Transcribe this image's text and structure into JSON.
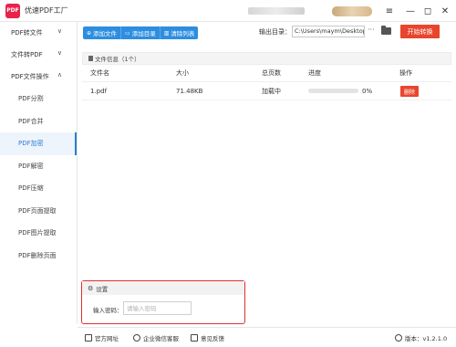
{
  "app": {
    "logo_text": "PDF",
    "title": "优速PDF工厂"
  },
  "window_controls": {
    "menu": "≡",
    "minimize": "—",
    "maximize": "◻",
    "close": "✕"
  },
  "sidebar": {
    "groups": [
      {
        "label": "PDF转文件",
        "chevron": "∨"
      },
      {
        "label": "文件转PDF",
        "chevron": "∨"
      },
      {
        "label": "PDF文件操作",
        "chevron": "∧"
      }
    ],
    "items": [
      {
        "label": "PDF分割"
      },
      {
        "label": "PDF合并"
      },
      {
        "label": "PDF加密",
        "active": true
      },
      {
        "label": "PDF解密"
      },
      {
        "label": "PDF压缩"
      },
      {
        "label": "PDF页面提取"
      },
      {
        "label": "PDF图片提取"
      },
      {
        "label": "PDF删除页面"
      }
    ]
  },
  "toolbar": {
    "add_file": "添加文件",
    "add_folder": "添加目录",
    "clear_list": "清除列表",
    "output_label": "输出目录：",
    "output_path": "C:\\Users\\maym\\Desktop",
    "more": "···",
    "start": "开始转换"
  },
  "file_list": {
    "info": "文件信息（1个）",
    "headers": {
      "name": "文件名",
      "size": "大小",
      "pages": "总页数",
      "progress": "进度",
      "action": "操作"
    },
    "rows": [
      {
        "name": "1.pdf",
        "size": "71.48KB",
        "pages": "加载中",
        "progress_pct": "0%",
        "progress_value": 0,
        "delete": "删除"
      }
    ]
  },
  "settings": {
    "title": "设置",
    "password_label": "输入密码：",
    "password_placeholder": "请输入密码",
    "password_value": ""
  },
  "statusbar": {
    "website": "官方网址",
    "wechat": "企业微信客服",
    "feedback": "意见反馈",
    "version": "版本：v1.2.1.0"
  },
  "colors": {
    "accent": "#2d8ee0",
    "danger": "#e8452c",
    "brand": "#e8224b",
    "highlight_border": "#e0302d"
  }
}
